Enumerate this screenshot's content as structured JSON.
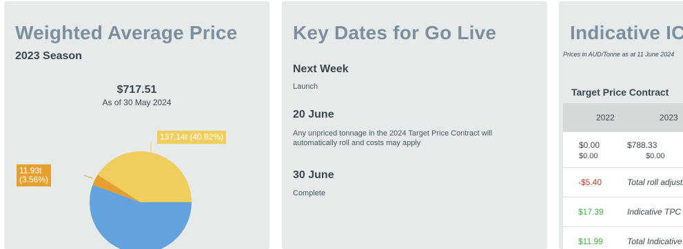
{
  "weighted": {
    "title": "Weighted Average Price",
    "season": "2023 Season",
    "price": "$717.51",
    "as_of": "As of 30 May 2024",
    "pie": {
      "slices": [
        {
          "label": "137.14t (40.92%)",
          "tonnes": 137.14,
          "percent": 40.92,
          "color": "#f0ce5d"
        },
        {
          "label": "11.93t\n(3.56%)",
          "tonnes": 11.93,
          "percent": 3.56,
          "color": "#e6a02f"
        },
        {
          "label": "",
          "percent": 55.52,
          "color": "#62a2dd"
        }
      ]
    }
  },
  "key_dates": {
    "title": "Key Dates for Go Live",
    "items": [
      {
        "heading": "Next Week",
        "text": "Launch"
      },
      {
        "heading": "20 June",
        "text": "Any unpriced tonnage in the 2024 Target Price Contract will automatically roll and costs may apply"
      },
      {
        "heading": "30 June",
        "text": "Complete"
      }
    ]
  },
  "indicative": {
    "title": "Indicative ICP",
    "note": "Prices in AUD/Tonne as at 11 June 2024",
    "section": "Target Price Contract",
    "columns": [
      "2022",
      "2023"
    ],
    "row_values": [
      {
        "a": "$0.00",
        "a2": "$0.00",
        "b": "$788.33",
        "b2": "$0.00"
      }
    ],
    "summary": [
      {
        "value": "-$5.40",
        "label": "Total roll adjustment"
      },
      {
        "value": "$17.39",
        "label": "Indicative TPC"
      },
      {
        "value": "$11.99",
        "label": "Total Indicative"
      }
    ]
  }
}
